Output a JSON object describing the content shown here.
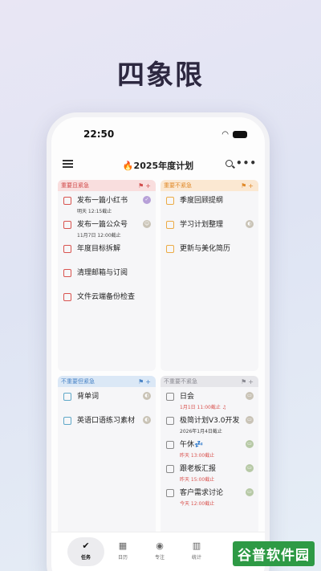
{
  "headline": "四象限",
  "status_bar": {
    "time": "22:50"
  },
  "nav": {
    "title": "🔥2025年度计划"
  },
  "quadrants": [
    {
      "label": "重要且紧急",
      "icons": "⚑+",
      "tasks": [
        {
          "name": "发布一篇小红书",
          "date": "明天 12:15截止",
          "date_color": "normal",
          "tag": "✓",
          "tag_style": "purple"
        },
        {
          "name": "发布一篇公众号",
          "date": "11月7日 12:00截止",
          "date_color": "normal",
          "tag": "☺",
          "tag_style": "beige"
        },
        {
          "name": "年度目标拆解",
          "date": "",
          "tag": ""
        },
        {
          "name": "清理邮箱与订阅",
          "date": "",
          "tag": ""
        },
        {
          "name": "文件云端备份检查",
          "date": "",
          "tag": ""
        }
      ]
    },
    {
      "label": "重要不紧急",
      "icons": "⚑+",
      "tasks": [
        {
          "name": "季度回顾提纲",
          "date": "",
          "tag": ""
        },
        {
          "name": "学习计划整理",
          "date": "",
          "tag": "◐",
          "tag_style": "beige"
        },
        {
          "name": "更新与美化简历",
          "date": "",
          "tag": ""
        }
      ]
    },
    {
      "label": "不重要但紧急",
      "icons": "⚑+",
      "tasks": [
        {
          "name": "背单词",
          "date": "",
          "tag": "◐",
          "tag_style": "beige"
        },
        {
          "name": "英语口语练习素材",
          "date": "",
          "tag": "◐",
          "tag_style": "beige"
        }
      ]
    },
    {
      "label": "不重要不紧急",
      "icons": "⚑+",
      "tasks": [
        {
          "name": "日会",
          "date": "1月1日 11:00截止 ♫",
          "date_color": "red",
          "tag": "▭",
          "tag_style": "beige"
        },
        {
          "name": "极简计划V3.0开发",
          "date": "2026年1月4日截止",
          "date_color": "normal",
          "tag": "▭",
          "tag_style": "beige"
        },
        {
          "name": "午休💤",
          "date": "昨天 13:00截止",
          "date_color": "red",
          "tag": "▭",
          "tag_style": "green"
        },
        {
          "name": "跟老板汇报",
          "date": "昨天 15:00截止",
          "date_color": "red",
          "tag": "▭",
          "tag_style": "green"
        },
        {
          "name": "客户需求讨论",
          "date": "今天 12:00截止",
          "date_color": "red",
          "tag": "▭",
          "tag_style": "green"
        }
      ]
    }
  ],
  "tabbar": [
    {
      "label": "任务",
      "icon": "✔",
      "active": true
    },
    {
      "label": "日历",
      "icon": "▦",
      "active": false
    },
    {
      "label": "专注",
      "icon": "◉",
      "active": false
    },
    {
      "label": "统计",
      "icon": "▥",
      "active": false
    }
  ],
  "watermark": {
    "text": "谷普软件园"
  }
}
